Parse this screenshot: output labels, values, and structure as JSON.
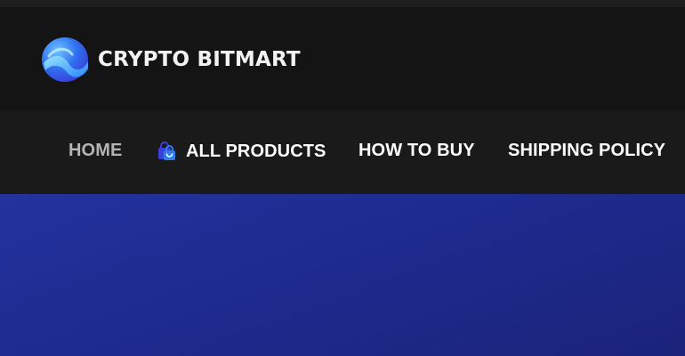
{
  "brand": {
    "name": "CRYPTO BITMART",
    "logo_icon": "wave-orb-logo-icon"
  },
  "nav": {
    "items": [
      {
        "label": "HOME",
        "active": true
      },
      {
        "label": "ALL PRODUCTS",
        "icon": "shopping-bag-icon"
      },
      {
        "label": "HOW TO BUY"
      },
      {
        "label": "SHIPPING POLICY"
      }
    ]
  },
  "colors": {
    "header_bg": "#141414",
    "nav_bg": "#1a1a1a",
    "nav_text": "#ffffff",
    "nav_active_text": "#b4b4b4",
    "accent_blue": "#2f7bf0",
    "hero_bg": "#1f2c90"
  }
}
